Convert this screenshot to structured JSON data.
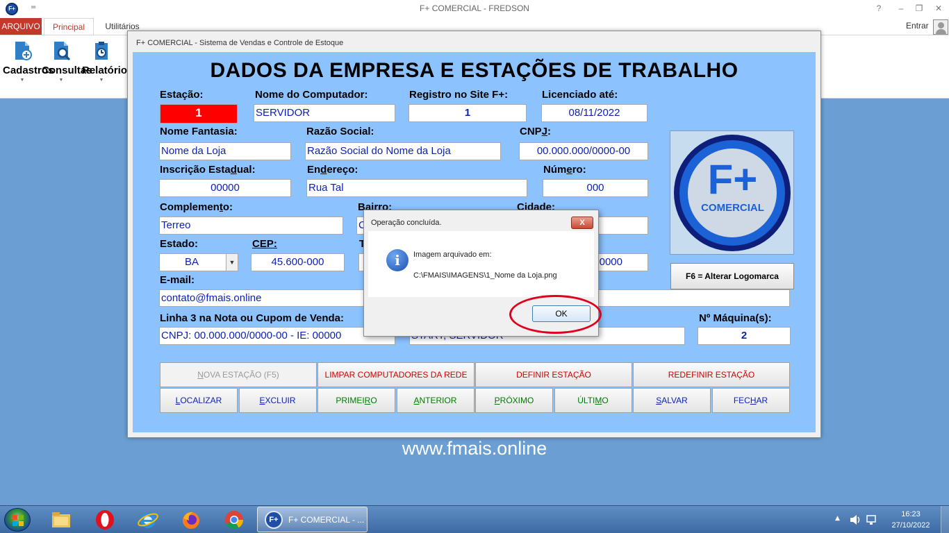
{
  "window": {
    "title": "F+ COMERCIAL - FREDSON",
    "qa_arrow": "=",
    "logo_text": "F+",
    "controls": [
      "?",
      "–",
      "❐",
      "✕"
    ]
  },
  "ribbon": {
    "tabs": [
      "ARQUIVO",
      "Principal",
      "Utilitários"
    ],
    "entrar": "Entrar",
    "buttons": [
      {
        "label": "Cadastros",
        "dropdown": "▼"
      },
      {
        "label": "Consultas",
        "dropdown": "▼"
      },
      {
        "label": "Relatórios",
        "dropdown": "▼"
      }
    ]
  },
  "form": {
    "caption": "F+ COMERCIAL - Sistema de Vendas e Controle de Estoque",
    "title": "DADOS DA EMPRESA E ESTAÇÕES DE TRABALHO",
    "labels": {
      "estacao": "Estação:",
      "nome_computador": "Nome do Computador:",
      "registro": "Registro no Site F+:",
      "licenciado": "Licenciado até:",
      "nome_fantasia": "Nome Fantasia:",
      "razao_social": "Razão Social:",
      "cnpj_a": "CNP",
      "cnpj_b": "J",
      "cnpj_c": ":",
      "ie_a": "Inscrição Esta",
      "ie_b": "d",
      "ie_c": "ual:",
      "end_a": "En",
      "end_b": "d",
      "end_c": "ereço:",
      "num_a": "Núm",
      "num_b": "e",
      "num_c": "ro:",
      "comp_a": "Complemen",
      "comp_b": "t",
      "comp_c": "o:",
      "bairro": "Bairro:",
      "cidade": "Cidade:",
      "estado": "Estado:",
      "cep": "CEP:",
      "tel_partial": "T",
      "email": "E-mail:",
      "linha3": "Linha 3 na Nota ou Cupom de Venda:",
      "maquinas": "Nº Máquina(s):"
    },
    "values": {
      "estacao": "1",
      "nome_computador": "SERVIDOR",
      "registro": "1",
      "licenciado": "08/11/2022",
      "nome_fantasia": "Nome da Loja",
      "razao_social": "Razão Social do Nome da Loja",
      "cnpj": "00.000.000/0000-00",
      "ie": "00000",
      "endereco": "Rua Tal",
      "numero": "000",
      "complemento": "Terreo",
      "bairro_partial": "C",
      "estado": "BA",
      "cep": "45.600-000",
      "tel_partial": "0000",
      "email": "contato@fmais.online",
      "linha3": "CNPJ: 00.000.000/0000-00 - IE: 00000",
      "estacoes_rede": "START, SERVIDOR",
      "maquinas": "2"
    },
    "logo": {
      "text_big": "F+",
      "text_small": "COMERCIAL"
    },
    "logo_button": "F6 = Alterar Logomarca",
    "buttons_row1": [
      {
        "pre": "",
        "u": "N",
        "post": "OVA ESTAÇÃO (F5)"
      },
      {
        "pre": "LIMPAR COMPUTADORES DA REDE",
        "u": "",
        "post": ""
      },
      {
        "pre": "DEFINIR ESTAÇÃO",
        "u": "",
        "post": ""
      },
      {
        "pre": "REDEFINIR ESTAÇÃO",
        "u": "",
        "post": ""
      }
    ],
    "buttons_row2": [
      {
        "pre": "",
        "u": "L",
        "post": "OCALIZAR"
      },
      {
        "pre": "",
        "u": "E",
        "post": "XCLUIR"
      },
      {
        "pre": "PRIMEI",
        "u": "R",
        "post": "O"
      },
      {
        "pre": "",
        "u": "A",
        "post": "NTERIOR"
      },
      {
        "pre": "",
        "u": "P",
        "post": "RÓXIMO"
      },
      {
        "pre": "ÚLTI",
        "u": "M",
        "post": "O"
      },
      {
        "pre": "",
        "u": "S",
        "post": "ALVAR"
      },
      {
        "pre": "FEC",
        "u": "H",
        "post": "AR"
      }
    ]
  },
  "watermark": "www.fmais.online",
  "dialog": {
    "title": "Operação concluída.",
    "close": "X",
    "icon": "i",
    "message_line1": "Imagem arquivado em:",
    "message_line2": "C:\\FMAIS\\IMAGENS\\1_Nome da Loja.png",
    "ok": "OK"
  },
  "taskbar": {
    "active_window": "F+ COMERCIAL - ...",
    "active_icon": "F+",
    "time": "16:23",
    "date": "27/10/2022",
    "tray_arrow": "▲"
  },
  "colors": {
    "accent": "#c0392b",
    "form_bg": "#8cc3ff",
    "value_text": "#0b1fb5",
    "station_red": "#ff0000",
    "desktop": "#6b9fd3"
  }
}
